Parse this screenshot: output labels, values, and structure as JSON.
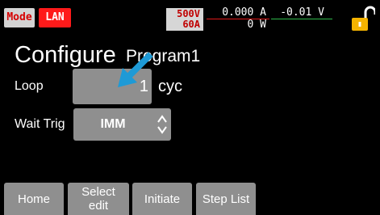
{
  "status": {
    "mode_label": "Mode",
    "lan_label": "LAN",
    "range_voltage": "500V",
    "range_current": "60A",
    "meas_current": "0.000 A",
    "meas_power": "0 W",
    "meas_voltage": "-0.01 V",
    "lock_icon": "unlocked-padlock-icon",
    "colors": {
      "mode_text": "#d60000",
      "lan_bg": "#ff1a1a",
      "range_text": "#c00000",
      "lock": "#f5b400"
    }
  },
  "screen": {
    "title": "Configure",
    "program": "Program1"
  },
  "fields": {
    "loop": {
      "label": "Loop",
      "value": "1",
      "unit": "cyc"
    },
    "wait_trig": {
      "label": "Wait Trig",
      "value": "IMM"
    }
  },
  "softkeys": {
    "home": "Home",
    "select_edit_1": "Select",
    "select_edit_2": "edit",
    "initiate": "Initiate",
    "step_list": "Step List"
  },
  "overlay": {
    "cursor_icon": "pointer-arrow-icon",
    "color": "#1e9ad6"
  }
}
